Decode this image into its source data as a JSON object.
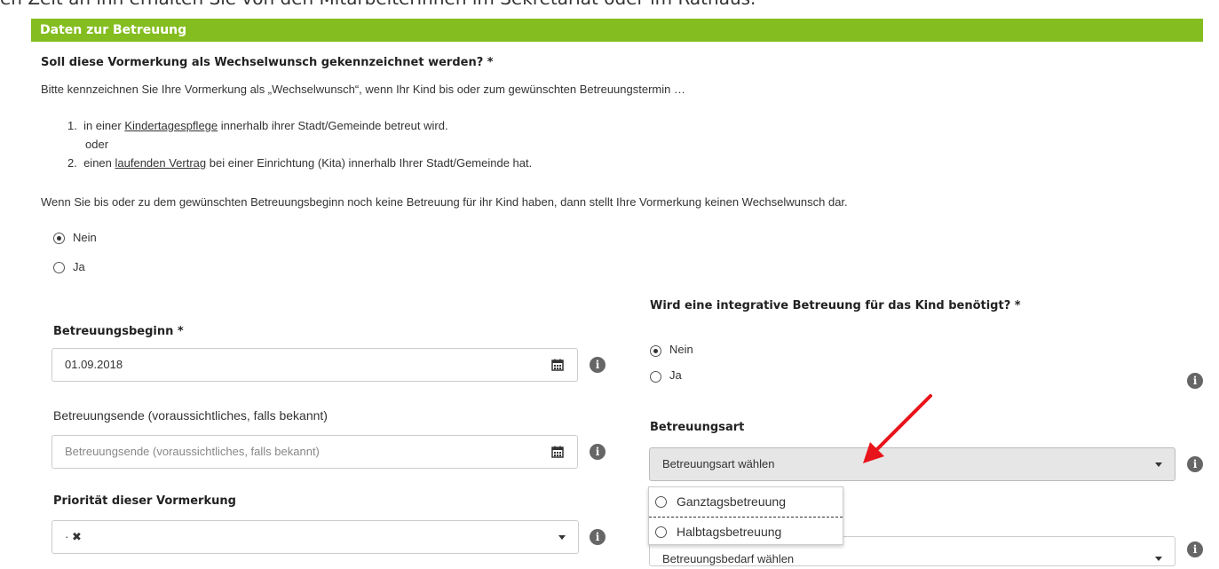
{
  "top_partial": "en Zeit an ihn erhalten Sie von den Mitarbeiterinnen im Sekretariat oder im Rathaus.",
  "section_title": "Daten zur Betreuung",
  "wechsel": {
    "question": "Soll diese Vormerkung als Wechselwunsch gekennzeichnet werden? *",
    "intro": "Bitte kennzeichnen Sie Ihre Vormerkung als „Wechselwunsch“, wenn Ihr Kind bis oder zum gewünschten Betreuungstermin …",
    "item1_num": "1.",
    "item1_pre": "in einer ",
    "item1_link": "Kindertagespflege",
    "item1_post": " innerhalb ihrer Stadt/Gemeinde betreut wird.",
    "oder": "oder",
    "item2_num": "2.",
    "item2_pre": "einen ",
    "item2_link": "laufenden Vertrag",
    "item2_post": " bei einer Einrichtung (Kita) innerhalb Ihrer Stadt/Gemeinde hat.",
    "note": "Wenn Sie bis oder zu dem gewünschten Betreuungsbeginn noch keine Betreuung für ihr Kind haben, dann stellt Ihre Vormerkung keinen Wechselwunsch dar.",
    "opt_nein": "Nein",
    "opt_ja": "Ja",
    "selected": "Nein"
  },
  "betreuungsbeginn": {
    "label": "Betreuungsbeginn *",
    "value": "01.09.2018"
  },
  "betreuungsende": {
    "label": "Betreuungsende (voraussichtliches, falls bekannt)",
    "placeholder": "Betreuungsende (voraussichtliches, falls bekannt)"
  },
  "prioritaet": {
    "label": "Priorität dieser Vormerkung",
    "value": "· ✖"
  },
  "integrativ": {
    "question": "Wird eine integrative Betreuung für das Kind benötigt? *",
    "opt_nein": "Nein",
    "opt_ja": "Ja",
    "selected": "Nein"
  },
  "betreuungsart": {
    "label": "Betreuungsart",
    "value": "Betreuungsart wählen",
    "options": [
      "Ganztagsbetreuung",
      "Halbtagsbetreuung"
    ]
  },
  "betreuungsbedarf": {
    "value": "Betreuungsbedarf wählen"
  },
  "info_glyph": "i",
  "colors": {
    "header_bg": "#84bd1f",
    "arrow": "#e8141b"
  }
}
